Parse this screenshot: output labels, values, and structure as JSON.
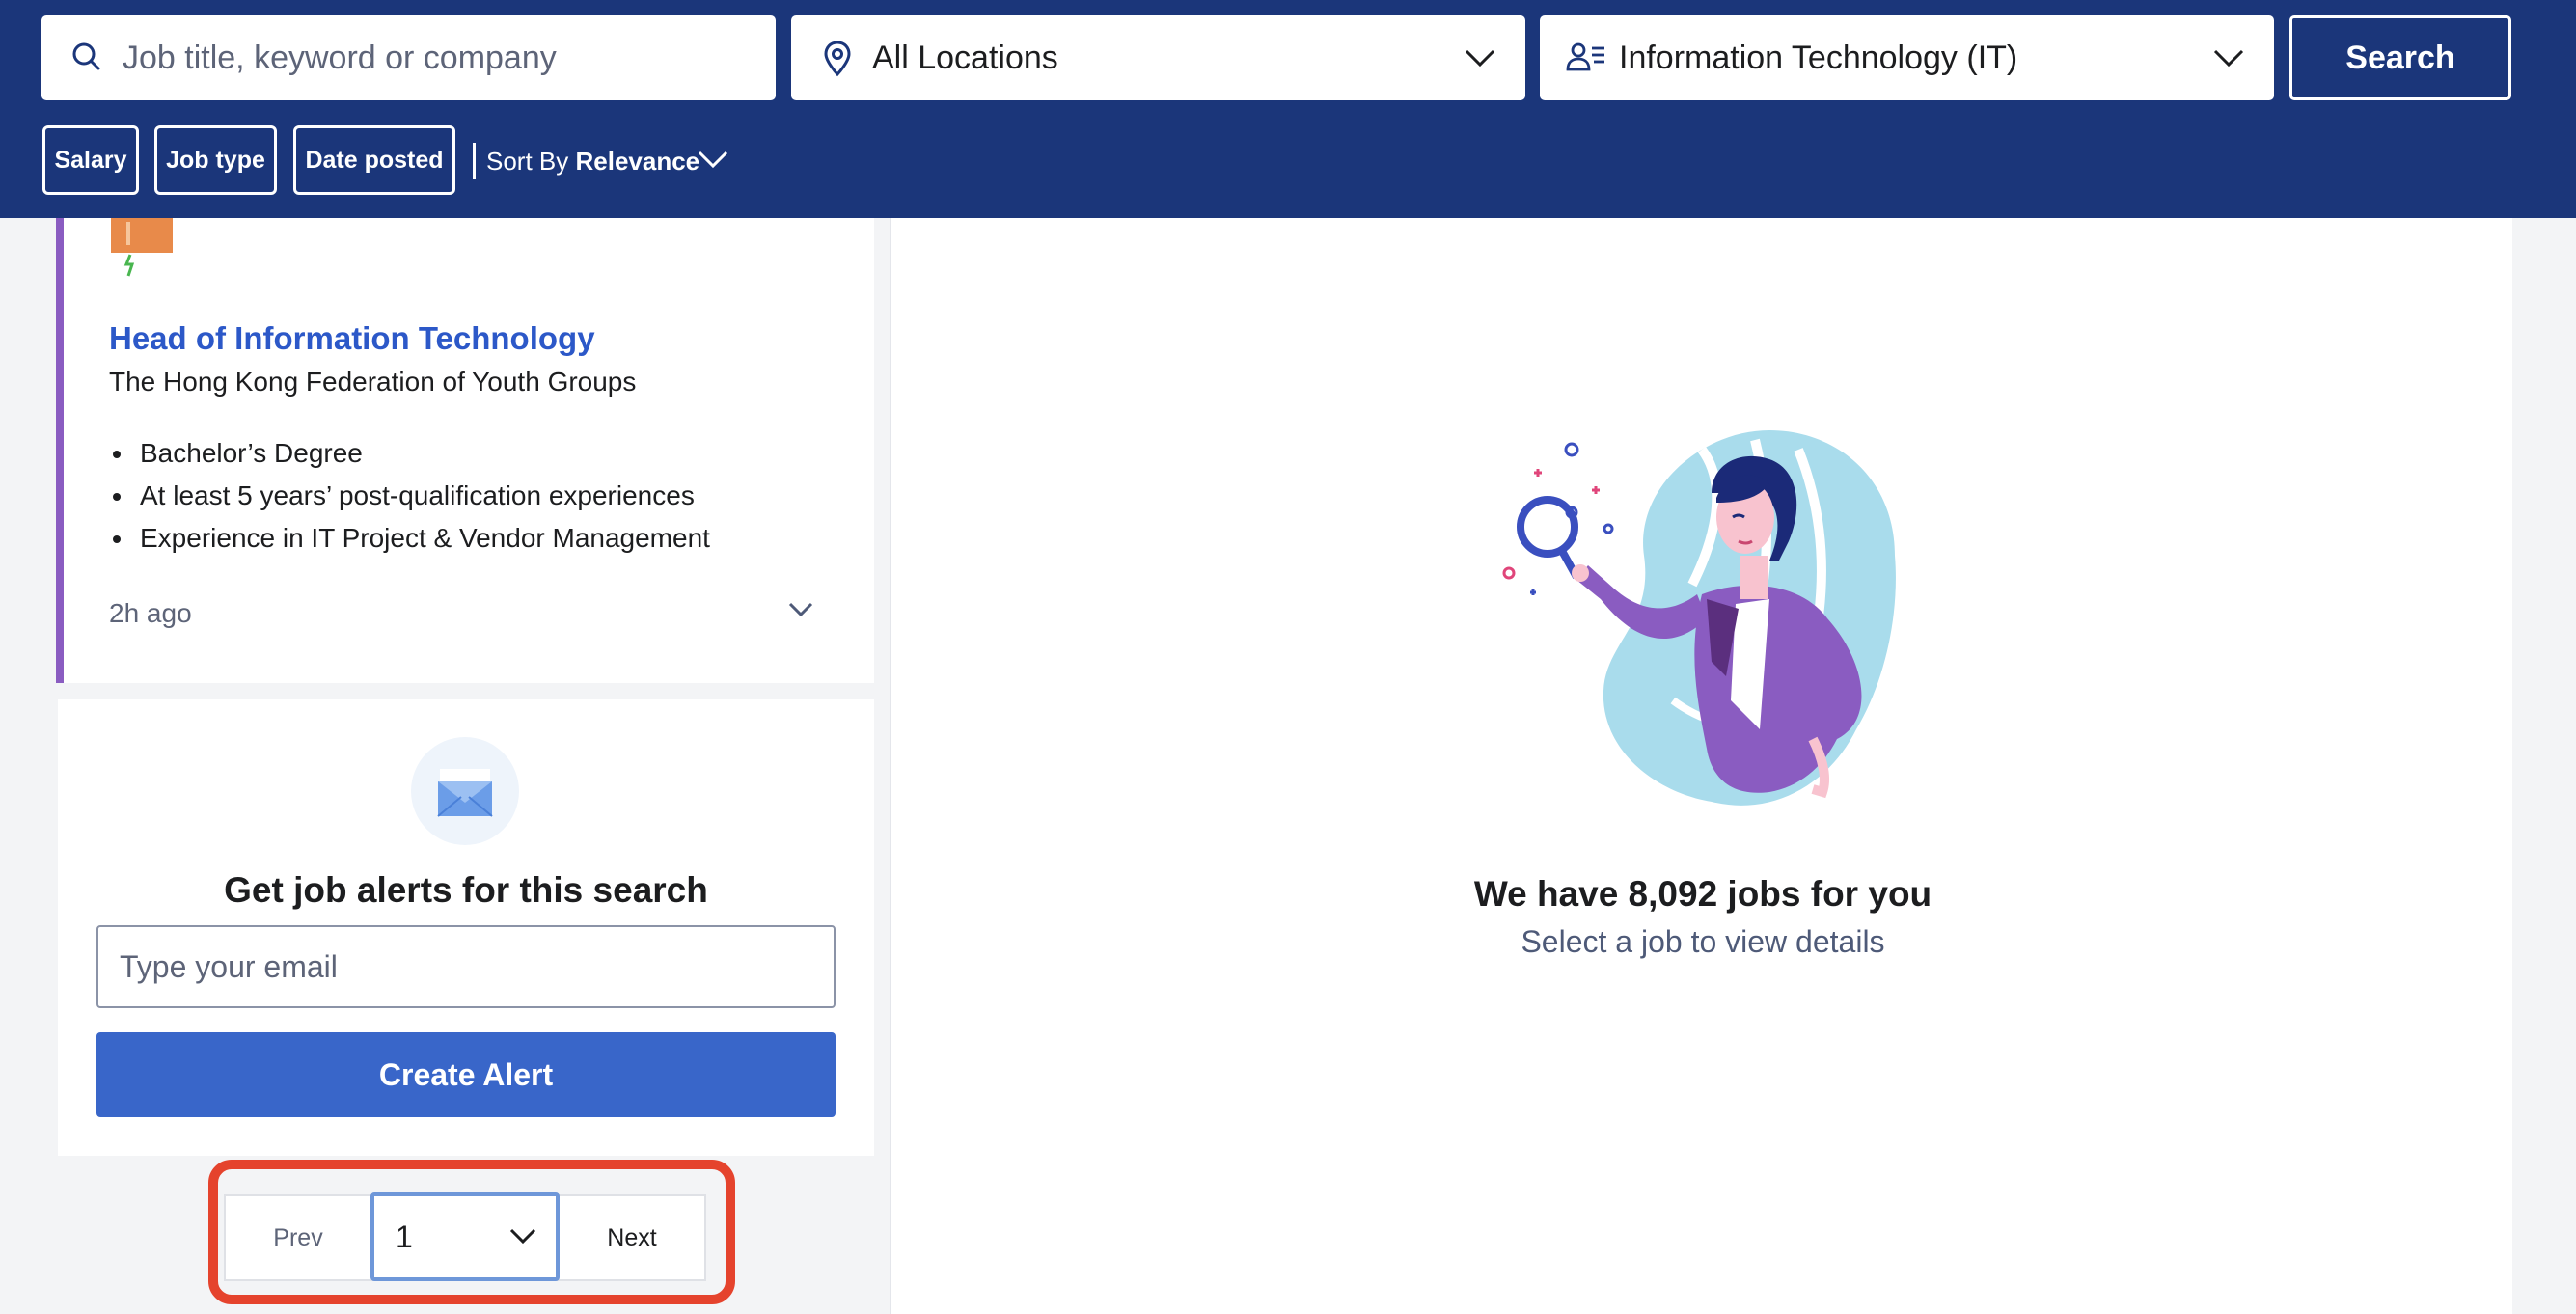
{
  "search": {
    "keyword_placeholder": "Job title, keyword or company",
    "location_value": "All Locations",
    "industry_value": "Information Technology (IT)",
    "search_label": "Search"
  },
  "filters": {
    "salary": "Salary",
    "job_type": "Job type",
    "date_posted": "Date posted",
    "sort_prefix": "Sort By",
    "sort_value": "Relevance"
  },
  "job": {
    "title": "Head of Information Technology",
    "company": "The Hong Kong Federation of Youth Groups",
    "bullets": [
      "Bachelor’s Degree",
      "At least 5 years’ post-qualification experiences",
      "Experience in IT Project & Vendor Management"
    ],
    "posted": "2h ago"
  },
  "alert": {
    "title": "Get job alerts for this search",
    "email_placeholder": "Type your email",
    "button": "Create Alert"
  },
  "pagination": {
    "prev": "Prev",
    "current_page": "1",
    "next": "Next"
  },
  "detail": {
    "title": "We have 8,092 jobs for you",
    "subtitle": "Select a job to view details"
  },
  "colors": {
    "header_bg": "#1b367a",
    "link_blue": "#2c58c8",
    "button_blue": "#3966c9",
    "card_accent": "#8a5cc1",
    "highlight_red": "#e5432d"
  }
}
